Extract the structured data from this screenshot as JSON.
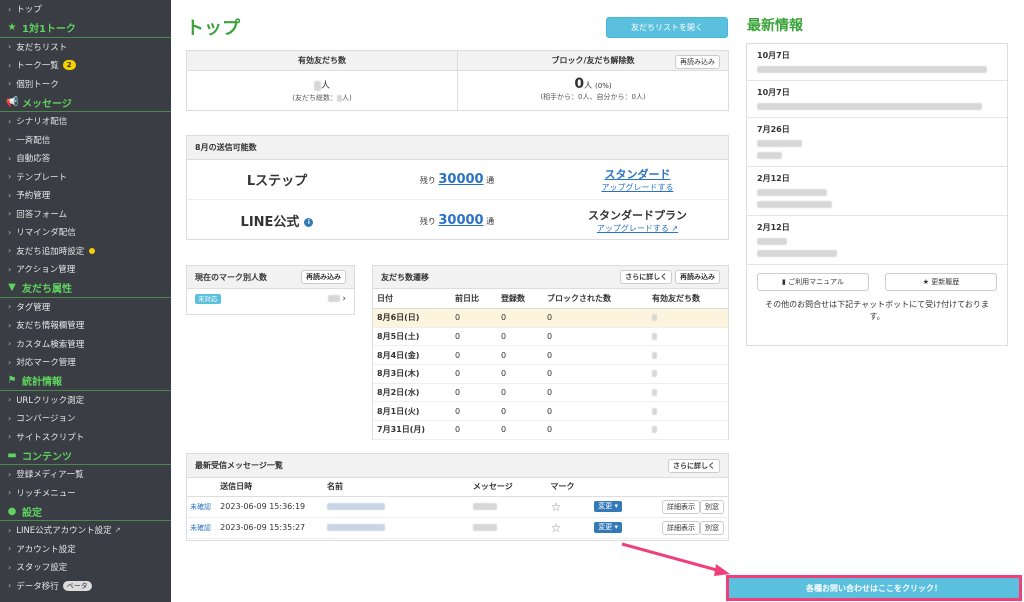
{
  "sidebar": {
    "items": [
      {
        "type": "item",
        "label": "トップ"
      },
      {
        "type": "head",
        "icon": "star-icon",
        "iconChar": "★",
        "label": "1対1トーク"
      },
      {
        "type": "item",
        "label": "友だちリスト"
      },
      {
        "type": "item",
        "label": "トーク一覧",
        "badge": "2"
      },
      {
        "type": "item",
        "label": "個別トーク"
      },
      {
        "type": "head",
        "icon": "megaphone-icon",
        "iconChar": "📢",
        "label": "メッセージ"
      },
      {
        "type": "item",
        "label": "シナリオ配信"
      },
      {
        "type": "item",
        "label": "一斉配信"
      },
      {
        "type": "item",
        "label": "自動応答"
      },
      {
        "type": "item",
        "label": "テンプレート"
      },
      {
        "type": "item",
        "label": "予約管理"
      },
      {
        "type": "item",
        "label": "回答フォーム"
      },
      {
        "type": "item",
        "label": "リマインダ配信"
      },
      {
        "type": "item",
        "label": "友だち追加時設定",
        "dot": true
      },
      {
        "type": "item",
        "label": "アクション管理"
      },
      {
        "type": "head",
        "icon": "filter-icon",
        "iconChar": "▼",
        "label": "友だち属性"
      },
      {
        "type": "item",
        "label": "タグ管理"
      },
      {
        "type": "item",
        "label": "友だち情報欄管理"
      },
      {
        "type": "item",
        "label": "カスタム検索管理"
      },
      {
        "type": "item",
        "label": "対応マーク管理"
      },
      {
        "type": "head",
        "icon": "flag-icon",
        "iconChar": "⚑",
        "label": "統計情報"
      },
      {
        "type": "item",
        "label": "URLクリック測定"
      },
      {
        "type": "item",
        "label": "コンバージョン"
      },
      {
        "type": "item",
        "label": "サイトスクリプト"
      },
      {
        "type": "head",
        "icon": "folder-icon",
        "iconChar": "▬",
        "label": "コンテンツ"
      },
      {
        "type": "item",
        "label": "登録メディア一覧"
      },
      {
        "type": "item",
        "label": "リッチメニュー"
      },
      {
        "type": "head",
        "icon": "chat-icon",
        "iconChar": "●",
        "label": "設定"
      },
      {
        "type": "item",
        "label": "LINE公式アカウント設定",
        "ext": true
      },
      {
        "type": "item",
        "label": "アカウント設定"
      },
      {
        "type": "item",
        "label": "スタッフ設定"
      },
      {
        "type": "item",
        "label": "データ移行",
        "beta": "ベータ"
      }
    ]
  },
  "header": {
    "title": "トップ",
    "open_friends_button": "友だちリストを開く"
  },
  "friends_summary": {
    "active_label": "有効友だち数",
    "active_unit": "人",
    "active_total": "(友だち総数：",
    "active_total_end": "人)",
    "blocked_label": "ブロック/友だち解除数",
    "blocked_value": "0",
    "blocked_unit": "人",
    "blocked_pct": "(0%)",
    "blocked_detail": "(相手から：0人、自分から：0人)",
    "reload": "再読み込み"
  },
  "quota": {
    "header": "8月の送信可能数",
    "rows": [
      {
        "name": "Lステップ",
        "remain_prefix": "残り",
        "remain_value": "30000",
        "remain_suffix": "通",
        "plan": "スタンダード",
        "plan_link": true,
        "upgrade": "アップグレードする"
      },
      {
        "name": "LINE公式",
        "remain_prefix": "残り",
        "remain_value": "30000",
        "remain_suffix": "通",
        "plan": "スタンダードプラン",
        "plan_link": false,
        "upgrade": "アップグレードする"
      }
    ]
  },
  "marks": {
    "header": "現在のマーク別人数",
    "reload": "再読み込み",
    "tag": "未対応"
  },
  "transition": {
    "header": "友だち数遷移",
    "more": "さらに詳しく",
    "reload": "再読み込み",
    "columns": [
      "日付",
      "前日比",
      "登録数",
      "ブロックされた数",
      "有効友だち数"
    ],
    "rows": [
      {
        "date": "8月6日(日)",
        "diff": "0",
        "reg": "0",
        "block": "0"
      },
      {
        "date": "8月5日(土)",
        "diff": "0",
        "reg": "0",
        "block": "0"
      },
      {
        "date": "8月4日(金)",
        "diff": "0",
        "reg": "0",
        "block": "0"
      },
      {
        "date": "8月3日(木)",
        "diff": "0",
        "reg": "0",
        "block": "0"
      },
      {
        "date": "8月2日(水)",
        "diff": "0",
        "reg": "0",
        "block": "0"
      },
      {
        "date": "8月1日(火)",
        "diff": "0",
        "reg": "0",
        "block": "0"
      },
      {
        "date": "7月31日(月)",
        "diff": "0",
        "reg": "0",
        "block": "0"
      }
    ]
  },
  "messages": {
    "header": "最新受信メッセージ一覧",
    "more": "さらに詳しく",
    "columns": [
      "送信日時",
      "名前",
      "メッセージ",
      "マーク"
    ],
    "rows": [
      {
        "status": "未確認",
        "datetime": "2023-06-09 15:36:19",
        "change": "変更",
        "detail": "詳細表示",
        "window": "別窓"
      },
      {
        "status": "未確認",
        "datetime": "2023-06-09 15:35:27",
        "change": "変更",
        "detail": "詳細表示",
        "window": "別窓"
      }
    ]
  },
  "news": {
    "title": "最新情報",
    "items": [
      {
        "date": "10月7日"
      },
      {
        "date": "10月7日"
      },
      {
        "date": "7月26日"
      },
      {
        "date": "2月12日"
      },
      {
        "date": "2月12日"
      }
    ],
    "manual_button": "ご利用マニュアル",
    "history_button": "更新履歴",
    "contact_text": "その他のお問合せは下記チャットボットにて受け付けております。"
  },
  "contact_bar": {
    "label": "各種お問い合わせはここをクリック！"
  },
  "colors": {
    "accent_green": "#3aa33a",
    "cyan": "#5bc0de",
    "pink": "#f0407a",
    "sidebar_bg": "#3a3d44"
  }
}
